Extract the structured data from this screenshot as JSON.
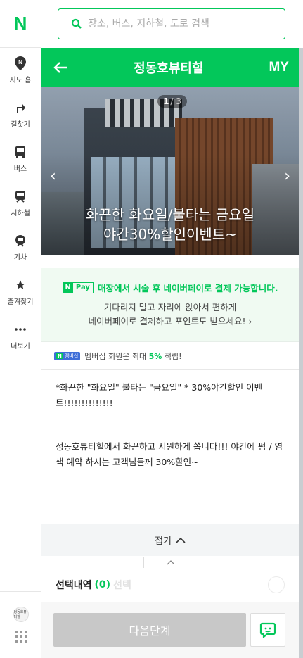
{
  "brand": {
    "logo": "N",
    "accent": "#03c75a"
  },
  "sidebar": {
    "items": [
      {
        "label": "지도 홈",
        "icon": "map-pin-icon"
      },
      {
        "label": "길찾기",
        "icon": "directions-icon"
      },
      {
        "label": "버스",
        "icon": "bus-icon"
      },
      {
        "label": "지하철",
        "icon": "subway-icon"
      },
      {
        "label": "기차",
        "icon": "train-icon"
      },
      {
        "label": "즐겨찾기",
        "icon": "star-icon"
      },
      {
        "label": "더보기",
        "icon": "more-icon"
      }
    ],
    "avatar_text": "정동호뷰티힐"
  },
  "search": {
    "placeholder": "장소, 버스, 지하철, 도로 검색"
  },
  "panel": {
    "title": "정동호뷰티힐",
    "my_label": "MY",
    "hero": {
      "page_current": "1",
      "page_total": "/ 3",
      "caption_line1": "화끈한 화요일/불타는 금요일",
      "caption_line2": "야간30%할인이벤트~"
    },
    "npay": {
      "badge_n": "N",
      "badge_pay": "Pay",
      "title": "매장에서 시술 후 네이버페이로 결제 가능합니다.",
      "desc_line1": "기다리지 말고 자리에 앉아서 편하게",
      "desc_line2": "네이버페이로 결제하고 포인트도 받으세요!"
    },
    "membership": {
      "badge": "멤버십",
      "text_prefix": "멤버십 회원은 최대",
      "percent": "5%",
      "text_suffix": "적립!"
    },
    "description": {
      "para1": "*화끈한 \"화요일\" 불타는 \"금요일\" * 30%야간할인 이벤트!!!!!!!!!!!!!!",
      "para2": "정동호뷰티힐에서 화끈하고 시원하게 쏩니다!!! 야간에 펌 / 염색 예약 하시는 고객님들께 30%할인~"
    },
    "fold_label": "접기",
    "selection": {
      "label": "선택내역",
      "count": "(0)",
      "ghost": "선택"
    },
    "next_button": "다음단계"
  }
}
